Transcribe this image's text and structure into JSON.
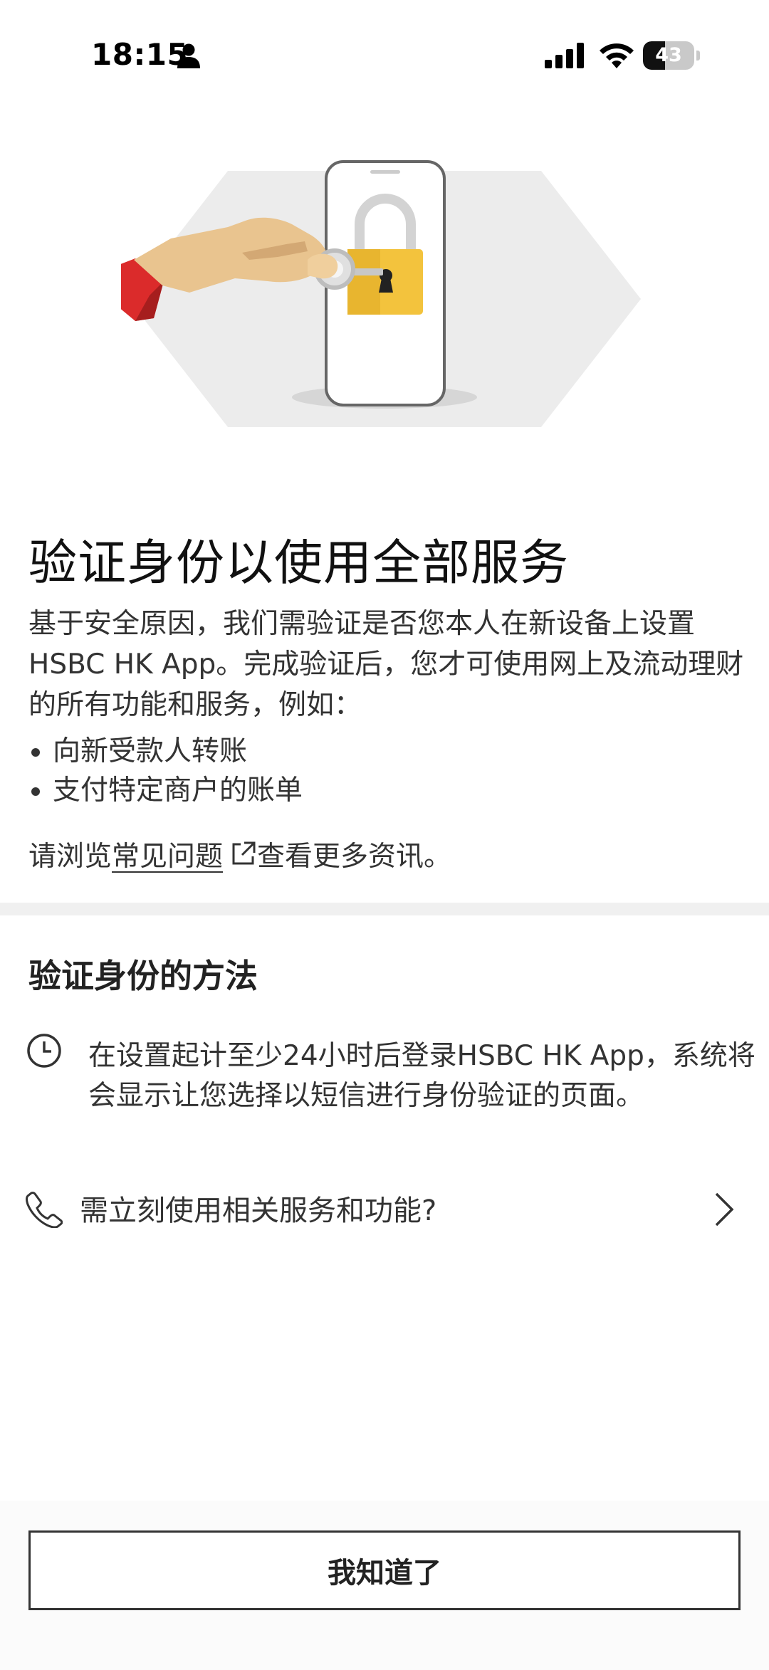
{
  "status_bar": {
    "time": "18:15",
    "battery_percent": "43",
    "battery_level": 0.43,
    "icons": [
      "person-icon",
      "cellular-signal-icon",
      "wifi-icon",
      "battery-icon"
    ]
  },
  "hero": {
    "icon": "hand-key-padlock-phone-illustration",
    "colors": {
      "padlock": "#f3c33d",
      "sleeve": "#db2b2b",
      "hexagon": "#ececec"
    }
  },
  "main": {
    "title": "验证身份以使用全部服务",
    "intro": "基于安全原因，我们需验证是否您本人在新设备上设置HSBC HK App。完成验证后，您才可使用网上及流动理财的所有功能和服务，例如：",
    "bullets": [
      "向新受款人转账",
      "支付特定商户的账单"
    ],
    "faq_prefix": "请浏览",
    "faq_link": "常见问题",
    "faq_suffix": "查看更多资讯。"
  },
  "methods": {
    "title": "验证身份的方法",
    "item_text": "在设置起计至少24小时后登录HSBC HK App，系统将会显示让您选择以短信进行身份验证的页面。",
    "item_icon": "clock-icon"
  },
  "help": {
    "text": "需立刻使用相关服务和功能?",
    "icon": "phone-icon"
  },
  "footer": {
    "button_label": "我知道了"
  }
}
